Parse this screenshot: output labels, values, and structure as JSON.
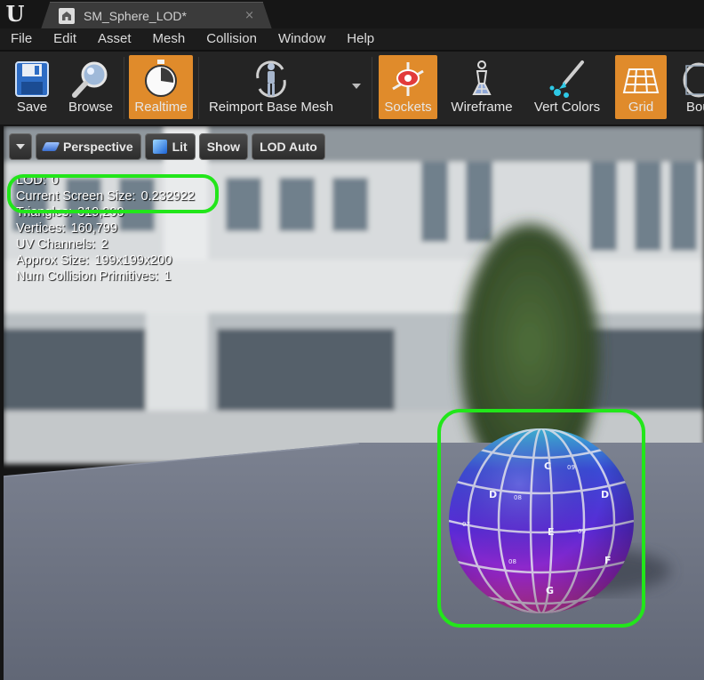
{
  "title_bar": {
    "tab_label": "SM_Sphere_LOD*",
    "tab_close": "×",
    "logo_letter": "U"
  },
  "menu": [
    "File",
    "Edit",
    "Asset",
    "Mesh",
    "Collision",
    "Window",
    "Help"
  ],
  "toolbar": {
    "buttons": [
      {
        "label": "Save",
        "icon": "floppy-disk-icon",
        "active": false
      },
      {
        "label": "Browse",
        "icon": "magnifier-icon",
        "active": false
      },
      {
        "label": "Realtime",
        "icon": "stopwatch-icon",
        "active": true
      },
      {
        "label": "Reimport Base Mesh",
        "icon": "mannequin-reimport-icon",
        "active": false
      },
      {
        "label": "Sockets",
        "icon": "socket-icon",
        "active": true
      },
      {
        "label": "Wireframe",
        "icon": "wireframe-pawn-icon",
        "active": false
      },
      {
        "label": "Vert Colors",
        "icon": "paint-brush-icon",
        "active": false
      },
      {
        "label": "Grid",
        "icon": "grid-icon",
        "active": true
      },
      {
        "label": "Bou",
        "icon": "bounds-icon",
        "active": false
      }
    ]
  },
  "viewport": {
    "buttons": {
      "perspective": "Perspective",
      "lit": "Lit",
      "show": "Show",
      "lod": "LOD Auto"
    },
    "stats": [
      {
        "label": "LOD:",
        "value": "0"
      },
      {
        "label": "Current Screen Size:",
        "value": "0.232922"
      },
      {
        "label": "Triangles:",
        "value": "319,200"
      },
      {
        "label": "Vertices:",
        "value": "160,799"
      },
      {
        "label": "UV Channels:",
        "value": "2"
      },
      {
        "label": "Approx Size:",
        "value": "199x199x200"
      },
      {
        "label": "Num Collision Primitives:",
        "value": "1"
      }
    ],
    "sphere_letters": [
      "C",
      "D",
      "D",
      "E",
      "F",
      "G"
    ],
    "sphere_numbers": [
      "09",
      "08",
      "09",
      "08",
      "07"
    ]
  },
  "colors": {
    "accent_active": "#e08b2b",
    "highlight": "#22e61a",
    "floor": "#6d7382"
  }
}
